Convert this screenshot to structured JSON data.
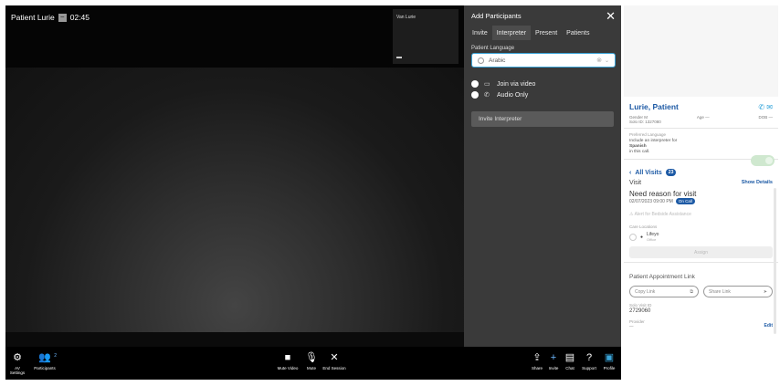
{
  "video": {
    "patient_label": "Patient Lurie",
    "timer": "02:45",
    "minimize_glyph": "−",
    "selfview_label": "Van Lurie"
  },
  "panel": {
    "title": "Add Participants",
    "close_glyph": "✕",
    "tabs": [
      "Invite",
      "Interpreter",
      "Present",
      "Patients"
    ],
    "active_tab": "Interpreter",
    "language_label": "Patient Language",
    "language_value": "Arabic",
    "options": [
      {
        "label": "Join via video",
        "icon": "video-camera-icon"
      },
      {
        "label": "Audio Only",
        "icon": "phone-icon"
      }
    ],
    "invite_button": "Invite Interpreter"
  },
  "controls": {
    "left": [
      {
        "label": "AV Settings",
        "glyph": "⚙"
      },
      {
        "label": "Participants",
        "glyph": "👥",
        "badge": "2"
      }
    ],
    "center": [
      {
        "label": "Mute Video",
        "glyph": "■"
      },
      {
        "label": "Mute",
        "glyph": "🎙"
      },
      {
        "label": "End Session",
        "glyph": "✕"
      }
    ],
    "right": [
      {
        "label": "Share",
        "glyph": "⇪"
      },
      {
        "label": "Invite",
        "glyph": "+"
      },
      {
        "label": "Chat",
        "glyph": "▤"
      },
      {
        "label": "Support",
        "glyph": "?"
      },
      {
        "label": "Profile",
        "glyph": "▣"
      }
    ]
  },
  "side": {
    "patient_name": "Lurie, Patient",
    "gender_label": "Gender",
    "gender_value": "M",
    "age_label": "Age",
    "age_value": "—",
    "dob_label": "DOB",
    "dob_value": "—",
    "solo_id": "Solo ID: 1327080",
    "pref_lang_label": "Preferred Language",
    "pref_text_1": "Include an interpreter for",
    "pref_lang": "Spanish",
    "pref_text_2": "in this call.",
    "all_visits": "All Visits",
    "visit_count": "23",
    "visit_label": "Visit",
    "show_details": "Show Details",
    "reason": "Need reason for visit",
    "visit_date": "02/07/2023 09:00 PM",
    "on_call": "On Call",
    "alert": "Alert for Bedside Assistance",
    "care_locations": "Care Locations",
    "location_name": "Lifeyo",
    "location_sub": "Office",
    "assign": "Assign",
    "appt_link": "Patient Appointment Link",
    "copy_link": "Copy Link",
    "share_link": "Share Link",
    "session_id_label": "Solo Visit ID",
    "session_id": "2729060",
    "provider_label": "Provider",
    "provider_value": "—",
    "edit": "Edit"
  }
}
